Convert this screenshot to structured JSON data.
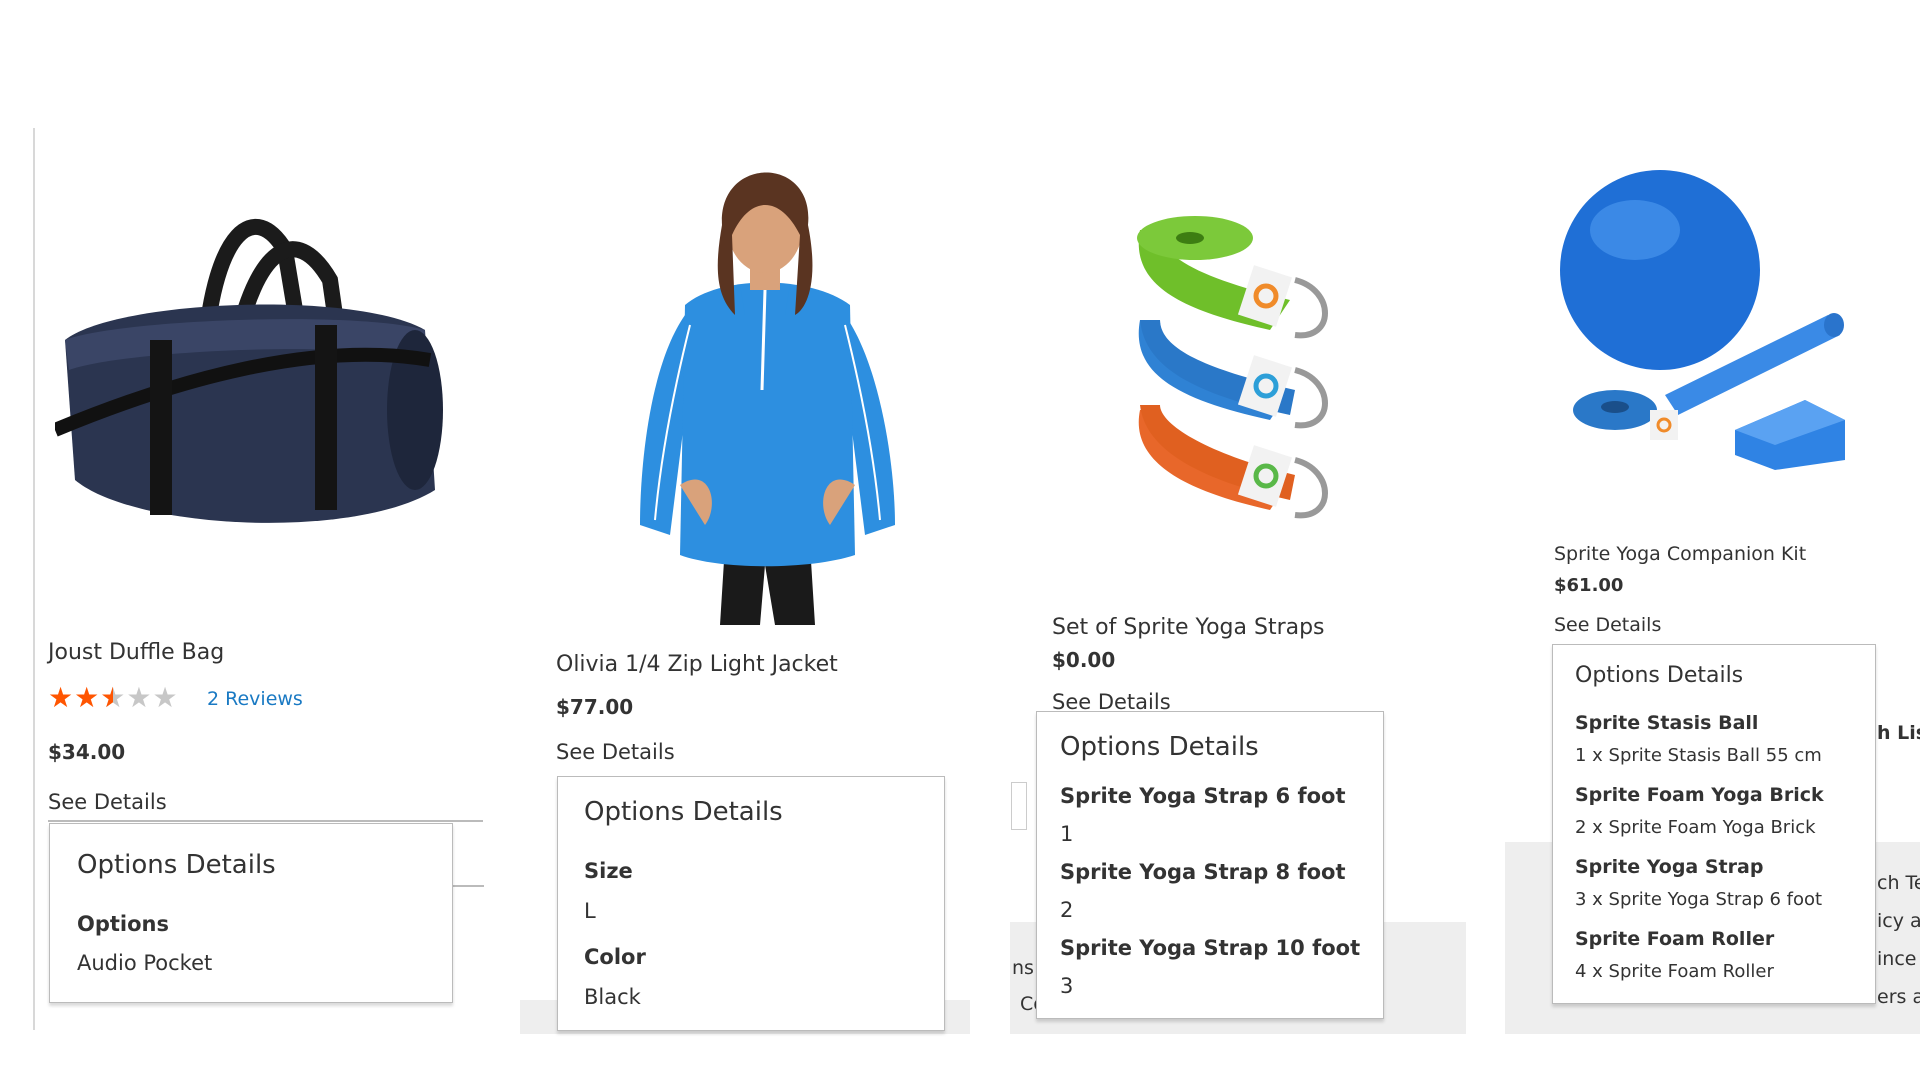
{
  "products": [
    {
      "name": "Joust Duffle Bag",
      "rating": {
        "stars_filled": 2.5,
        "stars_total": 5,
        "reviews_label": "2 Reviews"
      },
      "price": "$34.00",
      "see_details": "See Details",
      "options": {
        "title": "Options Details",
        "rows": [
          {
            "label": "Options",
            "value": "Audio Pocket"
          }
        ]
      }
    },
    {
      "name": "Olivia 1/4 Zip Light Jacket",
      "price": "$77.00",
      "see_details": "See Details",
      "options": {
        "title": "Options Details",
        "rows": [
          {
            "label": "Size",
            "value": "L"
          },
          {
            "label": "Color",
            "value": "Black"
          }
        ]
      }
    },
    {
      "name": "Set of Sprite Yoga Straps",
      "price": "$0.00",
      "see_details": "See Details",
      "options": {
        "title": "Options Details",
        "rows": [
          {
            "label": "Sprite Yoga Strap 6 foot",
            "value": "1"
          },
          {
            "label": "Sprite Yoga Strap 8 foot",
            "value": "2"
          },
          {
            "label": "Sprite Yoga Strap 10 foot",
            "value": "3"
          }
        ]
      }
    },
    {
      "name": "Sprite Yoga Companion Kit",
      "price": "$61.00",
      "see_details": "See Details",
      "options": {
        "title": "Options Details",
        "rows": [
          {
            "label": "Sprite Stasis Ball",
            "value": "1 x Sprite Stasis Ball 55 cm"
          },
          {
            "label": "Sprite Foam Yoga Brick",
            "value": "2 x Sprite Foam Yoga Brick"
          },
          {
            "label": "Sprite Yoga Strap",
            "value": "3 x Sprite Yoga Strap 6 foot"
          },
          {
            "label": "Sprite Foam Roller",
            "value": "4 x Sprite Foam Roller"
          }
        ]
      }
    }
  ],
  "background_fragments": {
    "strap_card": [
      "ns",
      "Co"
    ],
    "kit_card": [
      "h Lis",
      "ch Te",
      "icy ar",
      "ince",
      "ers ar"
    ]
  },
  "colors": {
    "star_on": "#ff5501",
    "link": "#1979c3",
    "jacket": "#2d8fe0",
    "ball": "#1f6fd6"
  }
}
